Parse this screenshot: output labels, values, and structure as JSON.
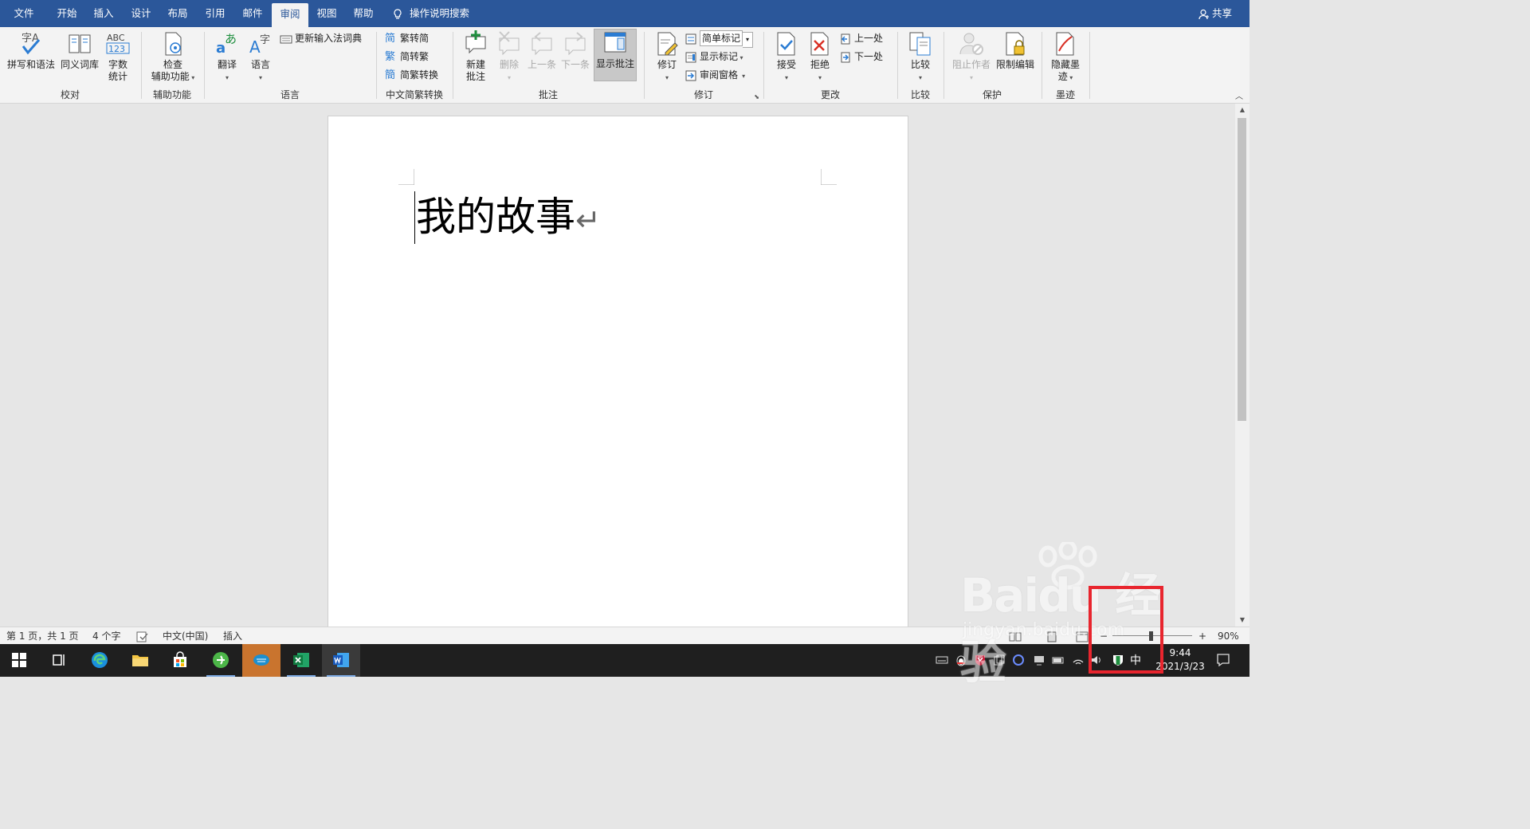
{
  "tabs": [
    "文件",
    "开始",
    "插入",
    "设计",
    "布局",
    "引用",
    "邮件",
    "审阅",
    "视图",
    "帮助"
  ],
  "active_tab": "审阅",
  "tell_me": "操作说明搜索",
  "share": "共享",
  "ribbon": {
    "proofing": {
      "label": "校对",
      "spelling": "拼写和语法",
      "thesaurus": "同义词库",
      "wordcount_l1": "字数",
      "wordcount_l2": "统计",
      "wordcount_icon_text": "ABC",
      "wordcount_icon_num": "123"
    },
    "accessibility": {
      "label": "辅助功能",
      "check_l1": "检查",
      "check_l2": "辅助功能"
    },
    "language": {
      "label": "语言",
      "translate": "翻译",
      "language": "语言",
      "update_ime": "更新输入法词典"
    },
    "chinese_conv": {
      "label": "中文简繁转换",
      "to_simplified": "繁转简",
      "to_traditional": "简转繁",
      "convert": "简繁转换"
    },
    "comments": {
      "label": "批注",
      "new_l1": "新建",
      "new_l2": "批注",
      "delete": "删除",
      "previous": "上一条",
      "next": "下一条",
      "show": "显示批注"
    },
    "tracking": {
      "label": "修订",
      "track": "修订",
      "markup_value": "简单标记",
      "show_markup": "显示标记",
      "reviewing_pane": "审阅窗格"
    },
    "changes": {
      "label": "更改",
      "accept": "接受",
      "reject": "拒绝",
      "previous": "上一处",
      "next": "下一处"
    },
    "compare": {
      "label": "比较",
      "compare": "比较"
    },
    "protect": {
      "label": "保护",
      "block_authors": "阻止作者",
      "restrict": "限制编辑"
    },
    "ink": {
      "label": "墨迹",
      "hide_l1": "隐藏墨",
      "hide_l2": "迹"
    }
  },
  "document": {
    "text": "我的故事",
    "paragraph_mark": "↵"
  },
  "status": {
    "page": "第 1 页，共 1 页",
    "words": "4 个字",
    "language": "中文(中国)",
    "mode": "插入",
    "zoom": "90%"
  },
  "taskbar": {
    "ime": "中",
    "time": "9:44",
    "date": "2021/3/23"
  },
  "watermark": {
    "main": "Baidu 经验",
    "sub": "jingyan.baidu.com"
  },
  "colors": {
    "word_blue": "#2b579a",
    "taskbar": "#1f1f1f",
    "highlight": "#e8252e"
  }
}
